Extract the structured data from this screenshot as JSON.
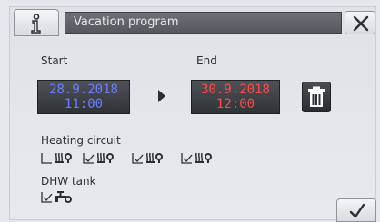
{
  "header": {
    "title": "Vacation program"
  },
  "period": {
    "start_label": "Start",
    "end_label": "End",
    "start_date": "28.9.2018",
    "start_time": "11:00",
    "end_date": "30.9.2018",
    "end_time": "12:00"
  },
  "heating": {
    "label": "Heating circuit",
    "circuits": [
      {
        "checked": false,
        "icon": "heating-circuit-icon"
      },
      {
        "checked": true,
        "icon": "heating-circuit-icon"
      },
      {
        "checked": true,
        "icon": "heating-circuit-icon"
      },
      {
        "checked": true,
        "icon": "heating-circuit-icon"
      }
    ]
  },
  "dhw": {
    "label": "DHW tank",
    "checked": true,
    "icon": "tap-icon"
  },
  "colors": {
    "start": "#6e7cff",
    "end": "#ff4a4a"
  }
}
